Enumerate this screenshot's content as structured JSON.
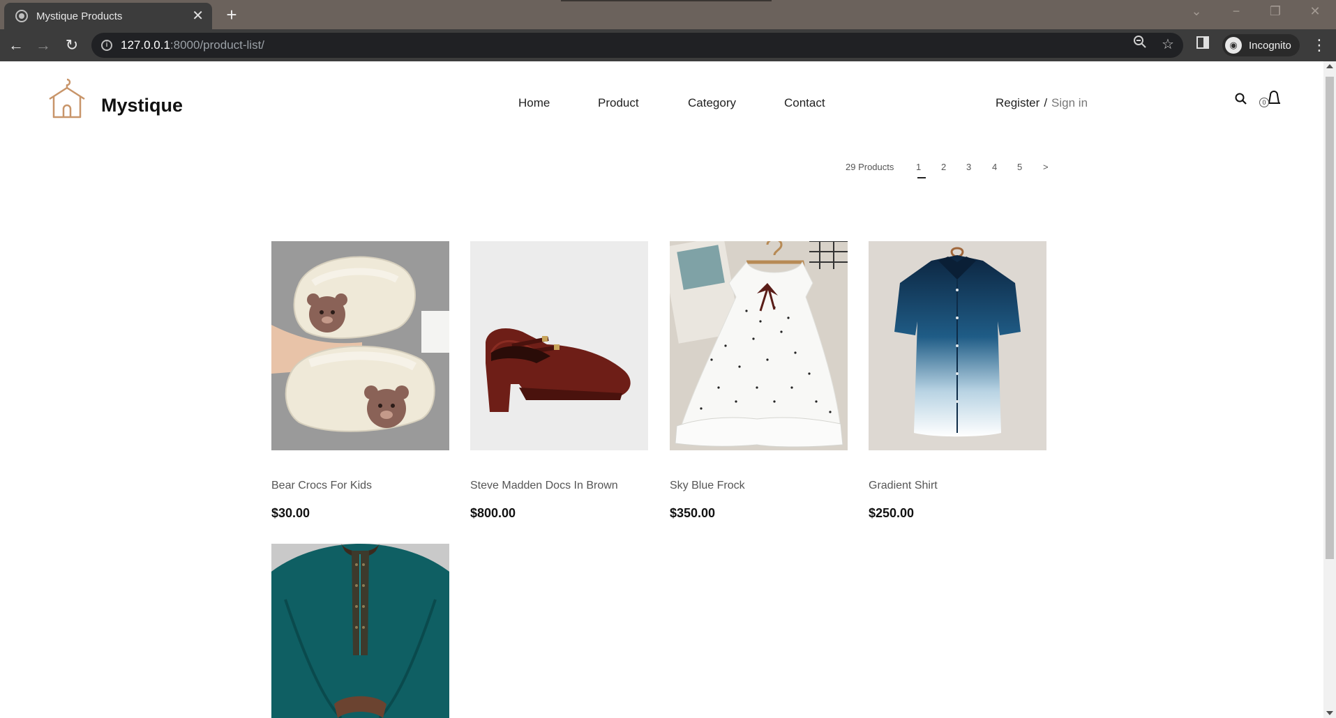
{
  "browser": {
    "tab_title": "Mystique Products",
    "tab_close": "✕",
    "new_tab": "+",
    "url_host": "127.0.0.1",
    "url_path": ":8000/product-list/",
    "profile_label": "Incognito"
  },
  "header": {
    "brand": "Mystique",
    "nav": [
      "Home",
      "Product",
      "Category",
      "Contact"
    ],
    "register": "Register",
    "separator": "/",
    "sign_in": "Sign in",
    "cart_count": "0"
  },
  "pagination": {
    "total_label": "29 Products",
    "pages": [
      "1",
      "2",
      "3",
      "4",
      "5"
    ],
    "next": ">",
    "active_page": "1"
  },
  "products": [
    {
      "name": "Bear Crocs For Kids",
      "price": "$30.00"
    },
    {
      "name": "Steve Madden Docs In Brown",
      "price": "$800.00"
    },
    {
      "name": "Sky Blue Frock",
      "price": "$350.00"
    },
    {
      "name": "Gradient Shirt",
      "price": "$250.00"
    },
    {
      "name": "",
      "price": ""
    }
  ],
  "colors": {
    "tabbar": "#6b625c",
    "toolbar": "#3c3c3c",
    "brand_accent": "#c8956a",
    "text_dark": "#111111"
  }
}
